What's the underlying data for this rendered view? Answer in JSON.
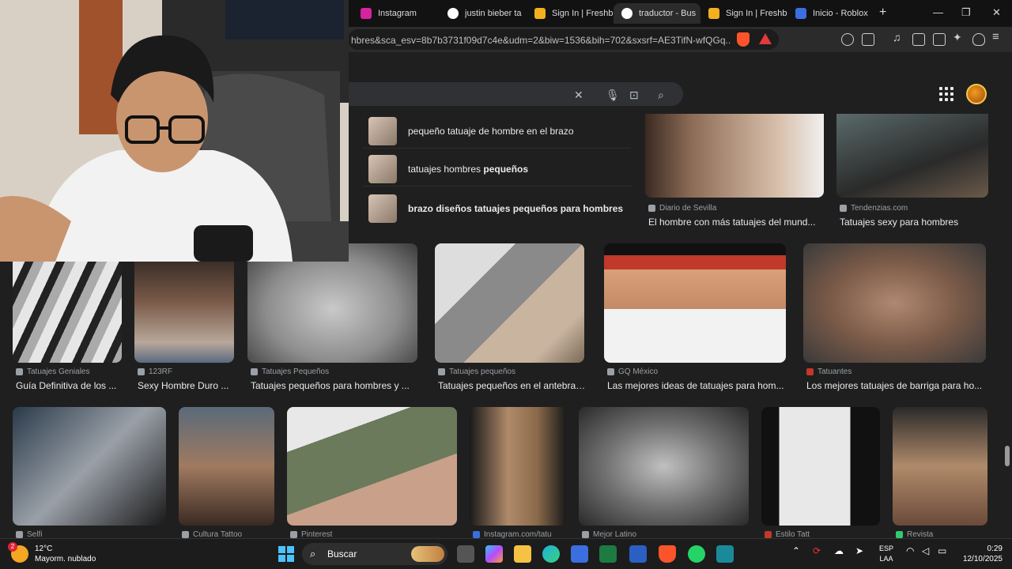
{
  "tabs": [
    {
      "label": "Instagram",
      "color": "#d6249f"
    },
    {
      "label": "justin bieber ta",
      "color": "#ffffff"
    },
    {
      "label": "Sign In | Freshb",
      "color": "#f2b01e"
    },
    {
      "label": "traductor - Bus",
      "color": "#ffffff"
    },
    {
      "label": "Sign In | Freshb",
      "color": "#f2b01e"
    },
    {
      "label": "Inicio - Roblox",
      "color": "#3b6fe0"
    }
  ],
  "window_controls": {
    "new_tab": "+",
    "minimize": "—",
    "maximize": "❐",
    "close": "✕"
  },
  "url": "hbres&sca_esv=8b7b3731f09d7c4e&udm=2&biw=1536&bih=702&sxsrf=AE3TifN-wfQGq...",
  "suggestions": [
    {
      "plain": "pequeño tatuaje de hombre en el brazo",
      "bold": ""
    },
    {
      "plain": "tatuajes hombres ",
      "bold": "pequeños"
    },
    {
      "plain": "",
      "bold": "brazo diseños tatuajes pequeños para hombres"
    }
  ],
  "top_results": [
    {
      "source": "Diario de Sevilla",
      "title": "El hombre con más tatuajes del mund..."
    },
    {
      "source": "Tendenzias.com",
      "title": "Tatuajes sexy para hombres"
    }
  ],
  "row1": [
    {
      "source": "Tatuajes Geniales",
      "title": "Guía Definitiva de los ..."
    },
    {
      "source": "123RF",
      "title": "Sexy Hombre Duro ..."
    },
    {
      "source": "Tatuajes Pequeños",
      "title": "Tatuajes pequeños para hombres y ..."
    },
    {
      "source": "Tatuajes pequeños",
      "title": "Tatuajes pequeños en el antebraz..."
    },
    {
      "source": "GQ México",
      "title": "Las mejores ideas de tatuajes para hom..."
    },
    {
      "source": "Tatuantes",
      "title": "Los mejores tatuajes de barriga para ho..."
    }
  ],
  "row2_sources": [
    "Selfi",
    "Cultura Tattoo",
    "Pinterest",
    "Instagram.com/tatu",
    "Mejor Latino",
    "Estilo Tatt",
    "Revista"
  ],
  "taskbar": {
    "temp": "12°C",
    "weather": "Mayorm. nublado",
    "badge": "2",
    "search": "Buscar",
    "lang1": "ESP",
    "lang2": "LAA",
    "time": "0:29",
    "date": "12/10/2025"
  }
}
